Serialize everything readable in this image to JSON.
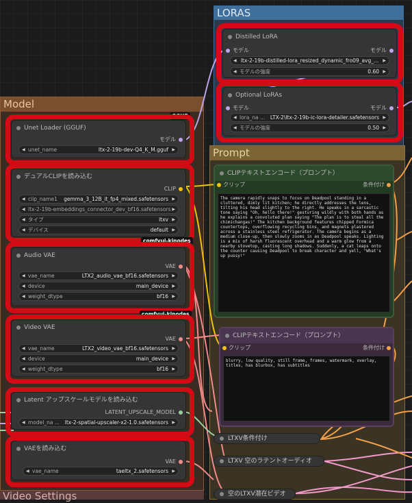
{
  "groups": {
    "loras": "LORAS",
    "model": "Model",
    "prompt": "Prompt",
    "video_settings": "Video Settings"
  },
  "distilled_lora": {
    "title": "Distilled LoRA",
    "in": "モデル",
    "out": "モデル",
    "file": "ltx-2-19b-distilled-lora_resized_dynamic_fro09_avg_...",
    "strength_label": "モデルの強度",
    "strength": "0.60"
  },
  "optional_loras": {
    "title": "Optional LoRAs",
    "in": "モデル",
    "out": "モデル",
    "lora_label": "lora_na ...",
    "lora_value": "LTX-2\\ltx-2-19b-ic-lora-detailer.safetensors",
    "strength_label": "モデルの強度",
    "strength": "0.50"
  },
  "unet": {
    "badge": "GGUF",
    "title": "Unet Loader (GGUF)",
    "out": "モデル",
    "label": "unet_name",
    "value": "ltx-2-19b-dev-Q4_K_M.gguf"
  },
  "dual_clip": {
    "title": "デュアルCLIPを読み込む",
    "out": "CLIP",
    "clip1_label": "clip_name1",
    "clip1_value": "gemma_3_12B_it_fp4_mixed.safetensors",
    "clip2_value": "ltx-2-19b-embeddings_connector_dev_bf16.safetensors",
    "type_label": "タイプ",
    "type_value": "ltxv",
    "device_label": "デバイス",
    "device_value": "default",
    "badge": "comfyui-kjnodes"
  },
  "audio_vae": {
    "title": "Audio VAE",
    "out": "VAE",
    "vae_label": "vae_name",
    "vae_value": "LTX2_audio_vae_bf16.safetensors",
    "device_label": "device",
    "device_value": "main_device",
    "dtype_label": "weight_dtype",
    "dtype_value": "bf16",
    "badge": "comfyui-kjnodes"
  },
  "video_vae": {
    "title": "Video VAE",
    "out": "VAE",
    "vae_label": "vae_name",
    "vae_value": "LTX2_video_vae_bf16.safetensors",
    "device_label": "device",
    "device_value": "main_device",
    "dtype_label": "weight_dtype",
    "dtype_value": "bf16"
  },
  "latent_upscale": {
    "title": "Latent アップスケールモデルを読み込む",
    "out": "LATENT_UPSCALE_MODEL",
    "label": "model_na ...",
    "value": "ltx-2-spatial-upscaler-x2-1.0.safetensors"
  },
  "vae_loader": {
    "title": "VAEを読み込む",
    "out": "VAE",
    "label": "vae_name",
    "value": "taeltx_2.safetensors"
  },
  "clip_pos": {
    "title": "CLIPテキストエンコード（プロンプト）",
    "in": "クリップ",
    "out": "条件付け",
    "text": "The camera rapidly snaps to focus on Deadpool standing in a cluttered, dimly lit kitchen; he directly addresses the lens, tilting his head slightly to the right. He speaks in a sarcastic tone saying \"Oh, hello there!\" gesturing wildly with both hands as he explains a convoluted plan saying \"The plan is to steal all the chimichangas!\" The kitchen background features chipped Formica countertops, overflowing recycling bins, and magnets plastered across a stainless steel refrigerator. The camera begins as a medium close-up, then slowly zooms in as Deadpool speaks. Lighting is a mix of harsh fluorescent overhead and a warm glow from a nearby stovetop, casting long shadows. Suddenly, a cat leaps onto the counter causing Deadpool to break character and yell, \"What's up pussy!\""
  },
  "clip_neg": {
    "title": "CLIPテキストエンコード（プロンプト）",
    "in": "クリップ",
    "out": "条件付け",
    "text": "blurry, low quality, still frame, frames, watermark, overlay, titles, has blurbox, has subtitles"
  },
  "collapsed": {
    "ltxv_cond": "LTXV条件付け",
    "ltxv_audio": "LTXV 空のラテントオーディオ",
    "ltxv_video": "空のLTXV潜在ビデオ"
  },
  "colors": {
    "highlight": "#d40a14",
    "prompt_group": "#8a6f3a",
    "model_group": "#8a5a36",
    "loras_group": "#3f6e9a"
  }
}
